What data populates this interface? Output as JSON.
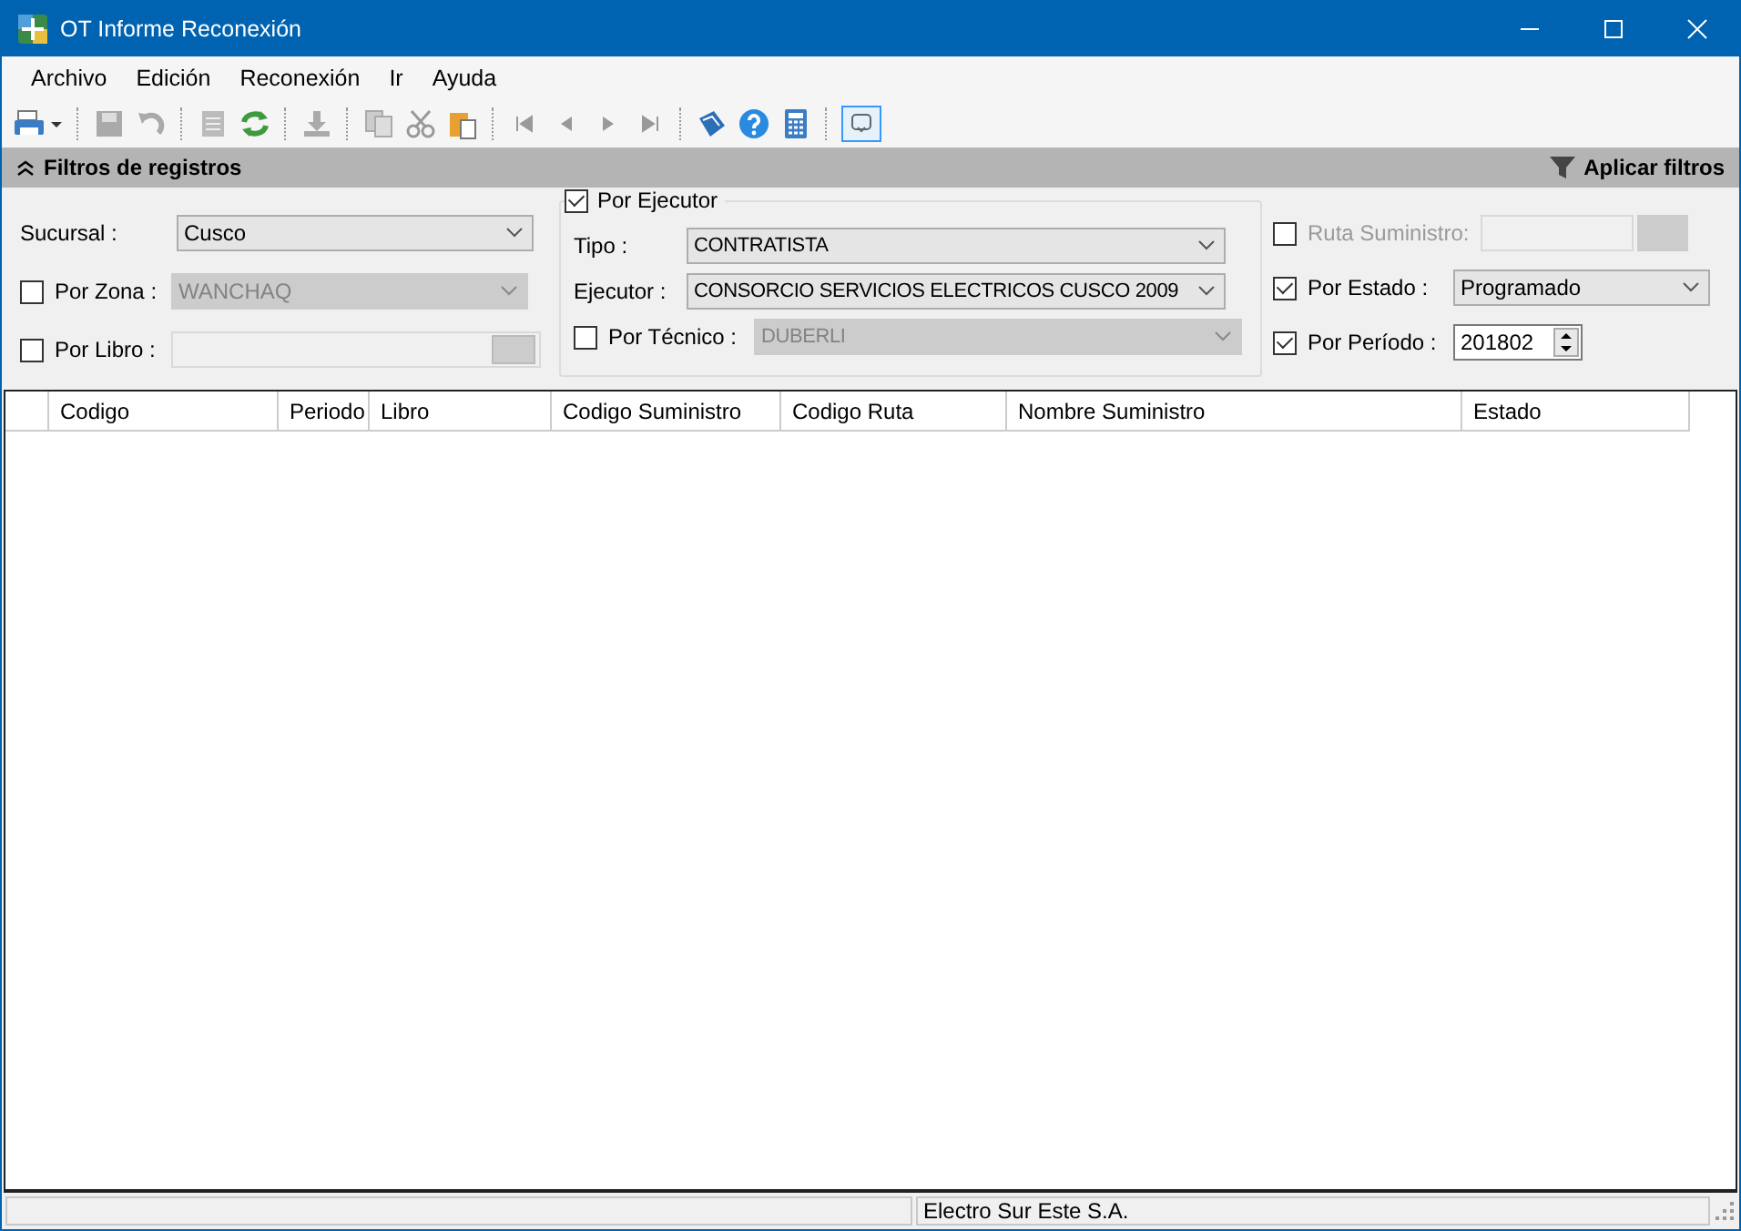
{
  "window": {
    "title": "OT Informe Reconexión"
  },
  "menu": [
    "Archivo",
    "Edición",
    "Reconexión",
    "Ir",
    "Ayuda"
  ],
  "filter_header": {
    "title": "Filtros de registros",
    "apply": "Aplicar filtros"
  },
  "sucursal": {
    "label": "Sucursal :",
    "value": "Cusco"
  },
  "por_zona": {
    "label": "Por Zona :",
    "checked": false,
    "value": "WANCHAQ"
  },
  "por_libro": {
    "label": "Por Libro :",
    "checked": false
  },
  "por_ejecutor": {
    "label": "Por Ejecutor",
    "checked": true,
    "tipo": {
      "label": "Tipo :",
      "value": "CONTRATISTA"
    },
    "ejecutor": {
      "label": "Ejecutor :",
      "value": "CONSORCIO SERVICIOS ELECTRICOS CUSCO 2009"
    },
    "por_tecnico": {
      "label": "Por Técnico :",
      "checked": false,
      "value": "DUBERLI"
    }
  },
  "ruta_suministro": {
    "label": "Ruta Suministro:",
    "checked": false,
    "disabled": true
  },
  "por_estado": {
    "label": "Por Estado :",
    "checked": true,
    "value": "Programado"
  },
  "por_periodo": {
    "label": "Por Período :",
    "checked": true,
    "value": "201802"
  },
  "table": {
    "columns": [
      "Codigo",
      "Periodo",
      "Libro",
      "Codigo Suministro",
      "Codigo Ruta",
      "Nombre Suministro",
      "Estado"
    ]
  },
  "status_bar": {
    "text": "Electro Sur Este S.A."
  }
}
